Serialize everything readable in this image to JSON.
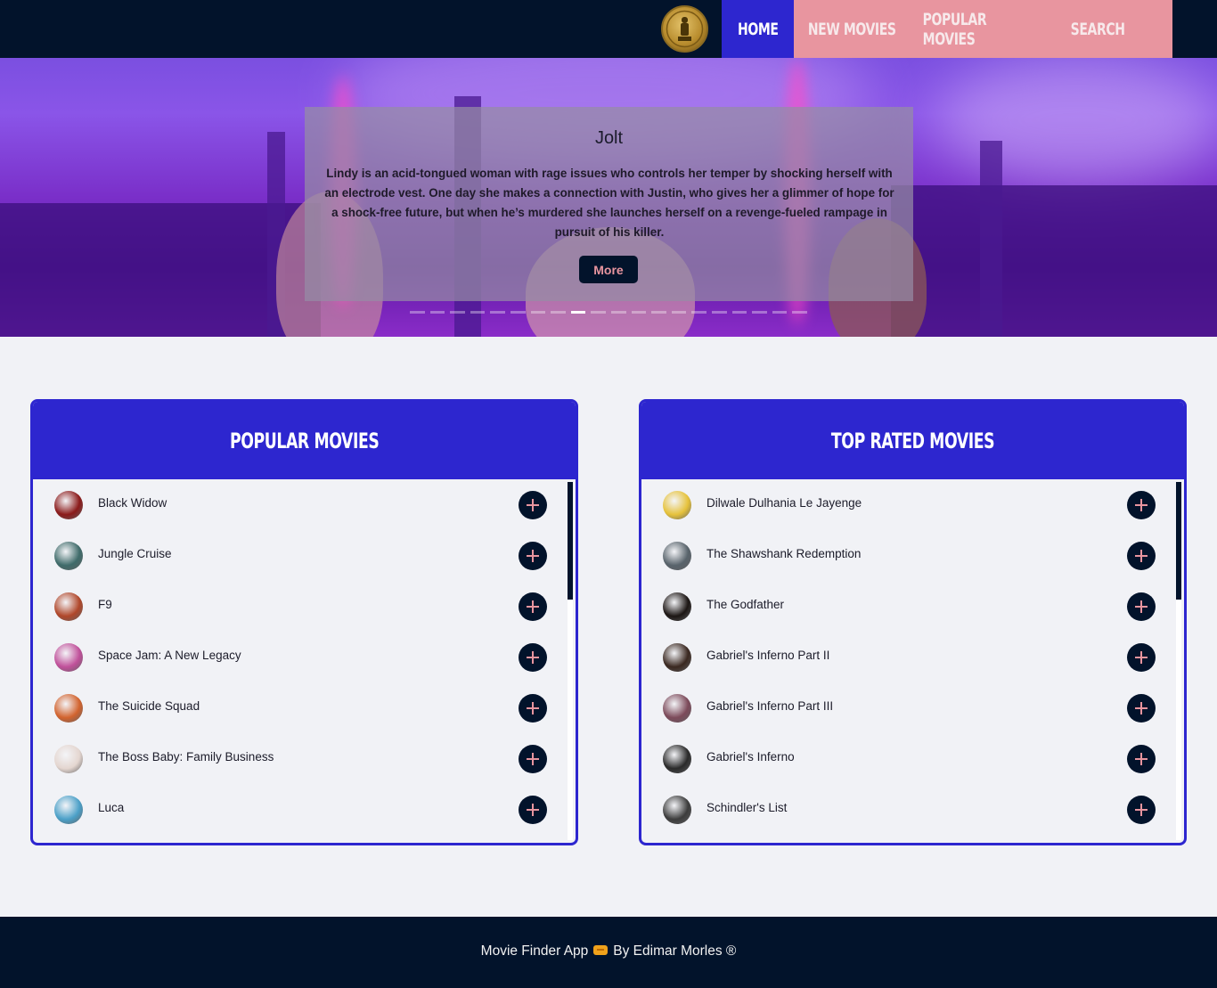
{
  "nav": {
    "items": [
      {
        "label": "Home",
        "active": true
      },
      {
        "label": "New Movies",
        "active": false
      },
      {
        "label": "Popular Movies",
        "active": false
      },
      {
        "label": "Search",
        "active": false
      }
    ],
    "logo_icon": "oscar-trophy-logo"
  },
  "hero": {
    "title": "Jolt",
    "overview": "Lindy is an acid-tongued woman with rage issues who controls her temper by shocking herself with an electrode vest. One day she makes a connection with Justin, who gives her a glimmer of hope for a shock-free future, but when he’s murdered she launches herself on a revenge-fueled rampage in pursuit of his killer.",
    "more_label": "More",
    "active_slide": 8,
    "slide_count": 20
  },
  "popular": {
    "title": "Popular Movies",
    "items": [
      {
        "title": "Black Widow",
        "thumb": "#8b1a1a"
      },
      {
        "title": "Jungle Cruise",
        "thumb": "#3f6b6a"
      },
      {
        "title": "F9",
        "thumb": "#b0472a"
      },
      {
        "title": "Space Jam: A New Legacy",
        "thumb": "#c0509a"
      },
      {
        "title": "The Suicide Squad",
        "thumb": "#d2632e"
      },
      {
        "title": "The Boss Baby: Family Business",
        "thumb": "#e4d6d0"
      },
      {
        "title": "Luca",
        "thumb": "#4ba0c8"
      }
    ]
  },
  "top_rated": {
    "title": "Top Rated Movies",
    "items": [
      {
        "title": "Dilwale Dulhania Le Jayenge",
        "thumb": "#e6c23b"
      },
      {
        "title": "The Shawshank Redemption",
        "thumb": "#58636b"
      },
      {
        "title": "The Godfather",
        "thumb": "#1c1614"
      },
      {
        "title": "Gabriel's Inferno Part II",
        "thumb": "#3a2820"
      },
      {
        "title": "Gabriel's Inferno Part III",
        "thumb": "#7c4a5a"
      },
      {
        "title": "Gabriel's Inferno",
        "thumb": "#2a2a2a"
      },
      {
        "title": "Schindler's List",
        "thumb": "#3c3c3c"
      }
    ]
  },
  "footer": {
    "app_name": "Movie Finder App",
    "author": "By Edimar Morles",
    "mark": "®",
    "icon": "ticket-icon"
  },
  "colors": {
    "navy": "#02132b",
    "accent": "#2d26cf",
    "pink": "#e8959f"
  }
}
